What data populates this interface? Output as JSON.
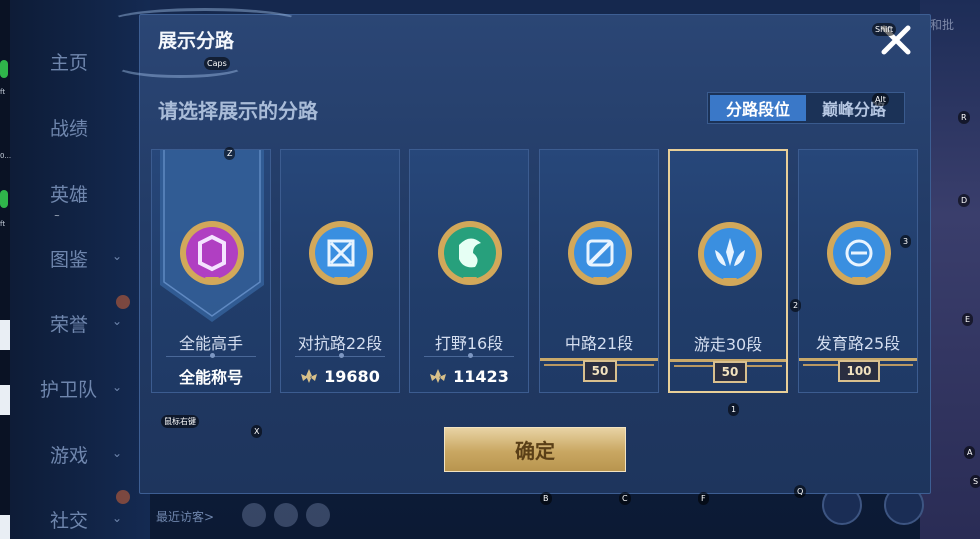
{
  "background": {
    "nav": [
      "主页",
      "战绩",
      "英雄",
      "图鉴",
      "荣誉",
      "护卫队",
      "游戏",
      "社交"
    ],
    "top_right_text": "和批",
    "bottom_text": "最近访客>",
    "left_strip_texts": [
      "ft",
      "0...",
      "ft",
      "~"
    ]
  },
  "dialog": {
    "title": "展示分路",
    "subtitle": "请选择展示的分路",
    "segments": [
      "分路段位",
      "巅峰分路"
    ],
    "active_segment": 0,
    "confirm_label": "确定"
  },
  "cards": [
    {
      "name": "全能高手",
      "footer_text": "全能称号",
      "badge_color": "#b03fc2",
      "icon": "medal-allround-icon"
    },
    {
      "name": "对抗路22段",
      "footer_value": "19680",
      "badge_color": "#3a8fe0",
      "icon": "medal-clash-icon"
    },
    {
      "name": "打野16段",
      "footer_value": "11423",
      "badge_color": "#27a07c",
      "icon": "medal-jungle-icon"
    },
    {
      "name": "中路21段",
      "level": "50",
      "badge_color": "#3a8fe0",
      "icon": "medal-mid-icon"
    },
    {
      "name": "游走30段",
      "level": "50",
      "badge_color": "#3a8fe0",
      "icon": "medal-roam-icon",
      "selected": true
    },
    {
      "name": "发育路25段",
      "level": "100",
      "badge_color": "#3a8fe0",
      "icon": "medal-farm-icon"
    }
  ],
  "key_hints": [
    "Caps",
    "Shift",
    "Alt",
    "Z",
    "R",
    "D",
    "3",
    "2",
    "E",
    "1",
    "X",
    "鼠标右键",
    "B",
    "C",
    "F",
    "Q",
    "A",
    "S"
  ],
  "colors": {
    "accent": "#3a78c8",
    "gold": "#c9a762",
    "selected_border": "#e8cf98"
  }
}
